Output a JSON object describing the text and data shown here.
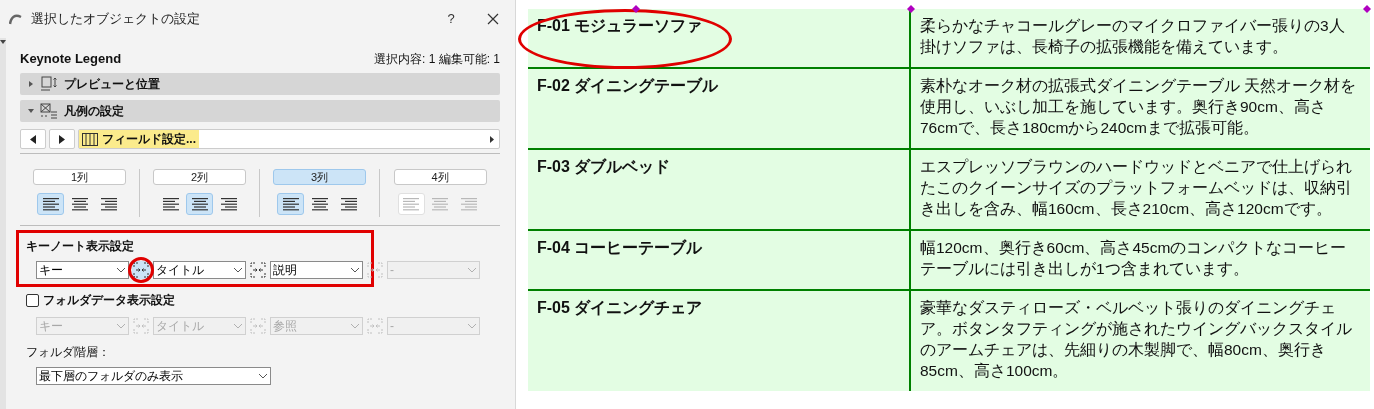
{
  "dialog": {
    "title": "選択したオブジェクトの設定",
    "help": "?",
    "heading": "Keynote Legend",
    "selection_info": "選択内容: 1 編集可能: 1",
    "sections": [
      {
        "label": "プレビューと位置",
        "expanded": false
      },
      {
        "label": "凡例の設定",
        "expanded": true
      }
    ],
    "nav": {
      "label": "フィールド設定..."
    },
    "columns": [
      {
        "label": "1列",
        "selected": false,
        "disabled": false,
        "alignments": [
          {
            "kind": "left",
            "selected": true
          },
          {
            "kind": "center",
            "selected": false
          },
          {
            "kind": "right",
            "selected": false
          }
        ]
      },
      {
        "label": "2列",
        "selected": false,
        "disabled": false,
        "alignments": [
          {
            "kind": "left",
            "selected": false
          },
          {
            "kind": "center",
            "selected": true
          },
          {
            "kind": "right",
            "selected": false
          }
        ]
      },
      {
        "label": "3列",
        "selected": true,
        "disabled": false,
        "alignments": [
          {
            "kind": "left",
            "selected": true
          },
          {
            "kind": "center",
            "selected": false
          },
          {
            "kind": "right",
            "selected": false
          }
        ]
      },
      {
        "label": "4列",
        "selected": false,
        "disabled": true,
        "alignments": [
          {
            "kind": "left",
            "selected": true
          },
          {
            "kind": "center",
            "selected": false
          },
          {
            "kind": "right",
            "selected": false
          }
        ]
      }
    ],
    "keynote": {
      "title": "キーノート表示設定",
      "fields": [
        {
          "value": "キー",
          "disabled": false
        },
        {
          "value": "タイトル",
          "disabled": false
        },
        {
          "value": "説明",
          "disabled": false
        },
        {
          "value": "-",
          "disabled": true
        }
      ],
      "joins": [
        {
          "selected": true,
          "disabled": false
        },
        {
          "selected": false,
          "disabled": false
        },
        {
          "selected": false,
          "disabled": true
        }
      ]
    },
    "folder": {
      "label": "フォルダデータ表示設定",
      "checked": false,
      "fields": [
        {
          "value": "キー",
          "disabled": true
        },
        {
          "value": "タイトル",
          "disabled": true
        },
        {
          "value": "参照",
          "disabled": true
        },
        {
          "value": "-",
          "disabled": true
        }
      ]
    },
    "hierarchy": {
      "label": "フォルダ階層：",
      "value": "最下層のフォルダのみ表示"
    }
  },
  "legend": {
    "rows": [
      {
        "title": "F-01 モジュラーソファ",
        "description": "柔らかなチャコールグレーのマイクロファイバー張りの3人掛けソファは、長椅子の拡張機能を備えています。"
      },
      {
        "title": "F-02 ダイニングテーブル",
        "description": "素朴なオーク材の拡張式ダイニングテーブル 天然オーク材を使用し、いぶし加工を施しています。奥行き90cm、高さ76cmで、長さ180cmから240cmまで拡張可能。"
      },
      {
        "title": "F-03 ダブルベッド",
        "description": "エスプレッソブラウンのハードウッドとベニアで仕上げられたこのクイーンサイズのプラットフォームベッドは、収納引き出しを含み、幅160cm、長さ210cm、高さ120cmです。"
      },
      {
        "title": "F-04 コーヒーテーブル",
        "description": "幅120cm、奥行き60cm、高さ45cmのコンパクトなコーヒーテーブルには引き出しが1つ含まれています。"
      },
      {
        "title": "F-05 ダイニングチェア",
        "description": "豪華なダスティローズ・ベルベット張りのダイニングチェア。ボタンタフティングが施されたウイングバックスタイルのアームチェアは、先細りの木製脚で、幅80cm、奥行き85cm、高さ100cm。"
      }
    ]
  }
}
